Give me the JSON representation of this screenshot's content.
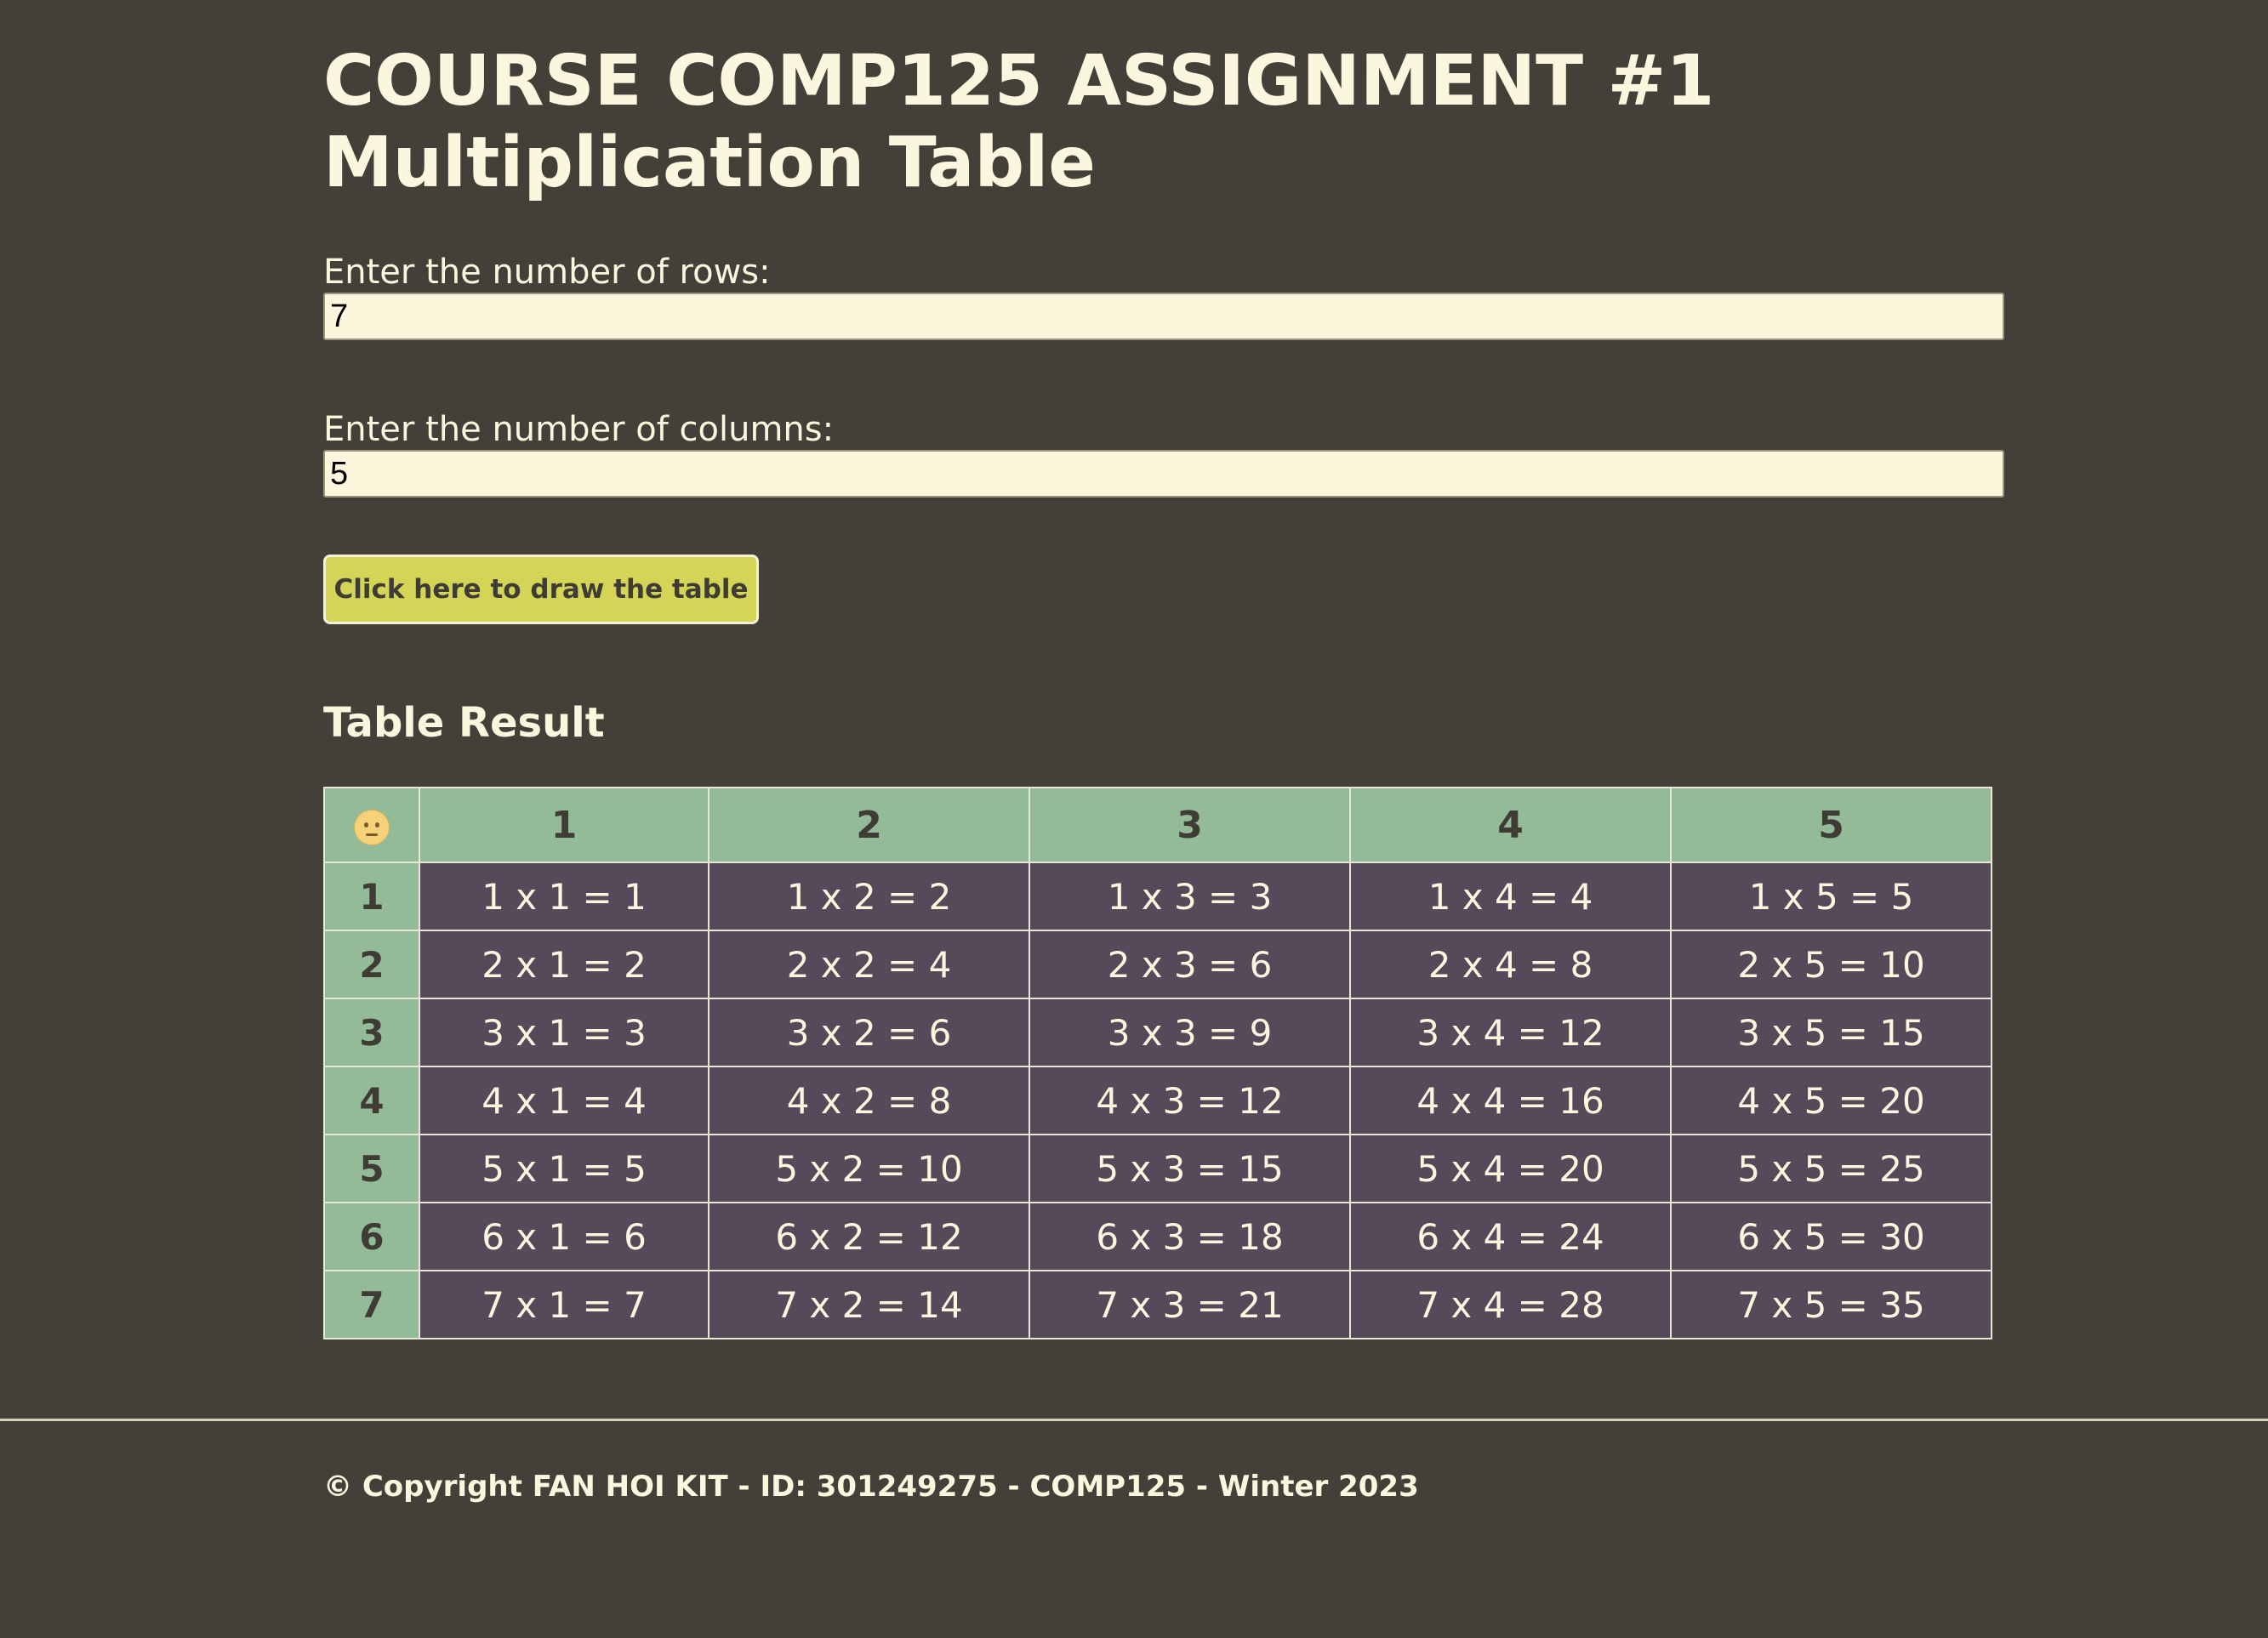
{
  "page": {
    "title_line1": "COURSE COMP125 ASSIGNMENT #1",
    "title_line2": "Multiplication Table"
  },
  "form": {
    "rows_label": "Enter the number of rows:",
    "rows_value": "7",
    "columns_label": "Enter the number of columns:",
    "columns_value": "5",
    "draw_button": "Click here to draw the table"
  },
  "result": {
    "title": "Table Result",
    "corner_icon": "smiley-face-icon",
    "column_headers": [
      "1",
      "2",
      "3",
      "4",
      "5"
    ],
    "rows": [
      {
        "header": "1",
        "cells": [
          "1 x 1 = 1",
          "1 x 2 = 2",
          "1 x 3 = 3",
          "1 x 4 = 4",
          "1 x 5 = 5"
        ]
      },
      {
        "header": "2",
        "cells": [
          "2 x 1 = 2",
          "2 x 2 = 4",
          "2 x 3 = 6",
          "2 x 4 = 8",
          "2 x 5 = 10"
        ]
      },
      {
        "header": "3",
        "cells": [
          "3 x 1 = 3",
          "3 x 2 = 6",
          "3 x 3 = 9",
          "3 x 4 = 12",
          "3 x 5 = 15"
        ]
      },
      {
        "header": "4",
        "cells": [
          "4 x 1 = 4",
          "4 x 2 = 8",
          "4 x 3 = 12",
          "4 x 4 = 16",
          "4 x 5 = 20"
        ]
      },
      {
        "header": "5",
        "cells": [
          "5 x 1 = 5",
          "5 x 2 = 10",
          "5 x 3 = 15",
          "5 x 4 = 20",
          "5 x 5 = 25"
        ]
      },
      {
        "header": "6",
        "cells": [
          "6 x 1 = 6",
          "6 x 2 = 12",
          "6 x 3 = 18",
          "6 x 4 = 24",
          "6 x 5 = 30"
        ]
      },
      {
        "header": "7",
        "cells": [
          "7 x 1 = 7",
          "7 x 2 = 14",
          "7 x 3 = 21",
          "7 x 4 = 28",
          "7 x 5 = 35"
        ]
      }
    ]
  },
  "footer": {
    "copyright": "© Copyright FAN HOI KIT - ID: 301249275 - COMP125 - Winter 2023"
  },
  "colors": {
    "background": "#434039",
    "text": "#fbf7de",
    "button": "#d4d457",
    "header_cell": "#93bb98",
    "body_cell": "#554a5a",
    "input_bg": "#fcf6dc"
  }
}
